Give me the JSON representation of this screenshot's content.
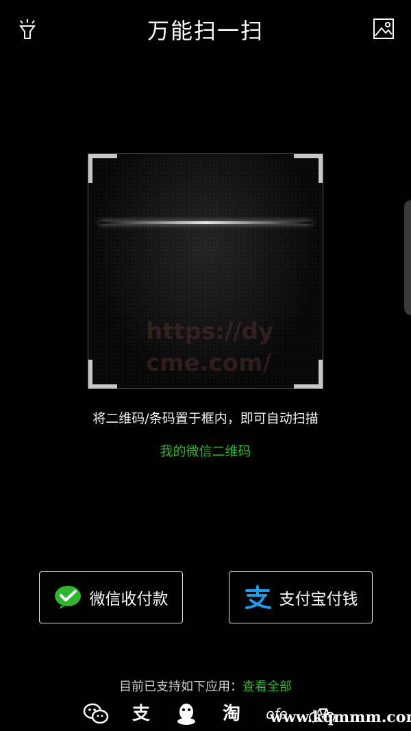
{
  "header": {
    "title": "万能扫一扫",
    "left_icon": "flashlight-icon",
    "right_icon": "gallery-icon"
  },
  "scanner": {
    "watermark": "https://dy\ncme.com/",
    "hint": "将二维码/条码置于框内，即可自动扫描",
    "my_qr_link": "我的微信二维码"
  },
  "buttons": {
    "wechat_pay": {
      "label": "微信收付款",
      "icon": "wechat-pay-icon"
    },
    "alipay_pay": {
      "label": "支付宝付钱",
      "icon": "alipay-icon"
    }
  },
  "support": {
    "prefix": "目前已支持如下应用：",
    "link": "查看全部"
  },
  "apps": [
    {
      "name": "wechat",
      "icon": "wechat-icon"
    },
    {
      "name": "alipay",
      "icon": "alipay-icon",
      "text": "支"
    },
    {
      "name": "qq",
      "icon": "qq-icon"
    },
    {
      "name": "taobao",
      "icon": "taobao-icon",
      "text": "淘"
    },
    {
      "name": "ofo",
      "icon": "ofo-icon",
      "text": "ofo"
    },
    {
      "name": "bike",
      "icon": "bike-icon"
    }
  ],
  "site_watermark": "www.kqmmm.com",
  "colors": {
    "accent_green": "#2fb52f",
    "alipay_blue": "#1b9ee6",
    "background": "#000000"
  }
}
